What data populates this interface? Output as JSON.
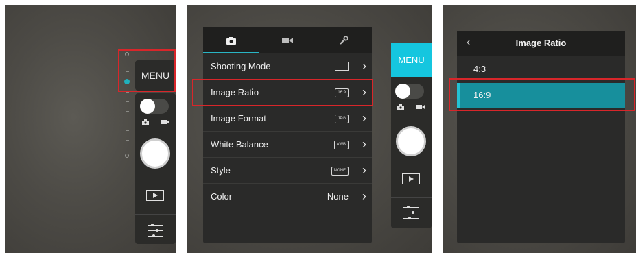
{
  "panel1": {
    "menu_label": "MENU"
  },
  "panel2": {
    "tabs": [
      {
        "icon": "photo-camera-icon"
      },
      {
        "icon": "video-camera-icon"
      },
      {
        "icon": "wrench-icon"
      }
    ],
    "rows": [
      {
        "label": "Shooting Mode",
        "value_icon": "single-shot-rect-icon"
      },
      {
        "label": "Image Ratio",
        "badge": "16:9"
      },
      {
        "label": "Image Format",
        "badge": "JPG"
      },
      {
        "label": "White Balance",
        "badge": "AWB"
      },
      {
        "label": "Style",
        "badge": "NONE"
      },
      {
        "label": "Color",
        "value": "None"
      }
    ],
    "menu_label": "MENU",
    "accent": "#15c6df"
  },
  "panel3": {
    "title": "Image Ratio",
    "options": [
      {
        "label": "4:3"
      },
      {
        "label": "16:9"
      }
    ],
    "selected": "16:9",
    "highlight": "#178f9c"
  },
  "highlight_color": "#d8262a"
}
